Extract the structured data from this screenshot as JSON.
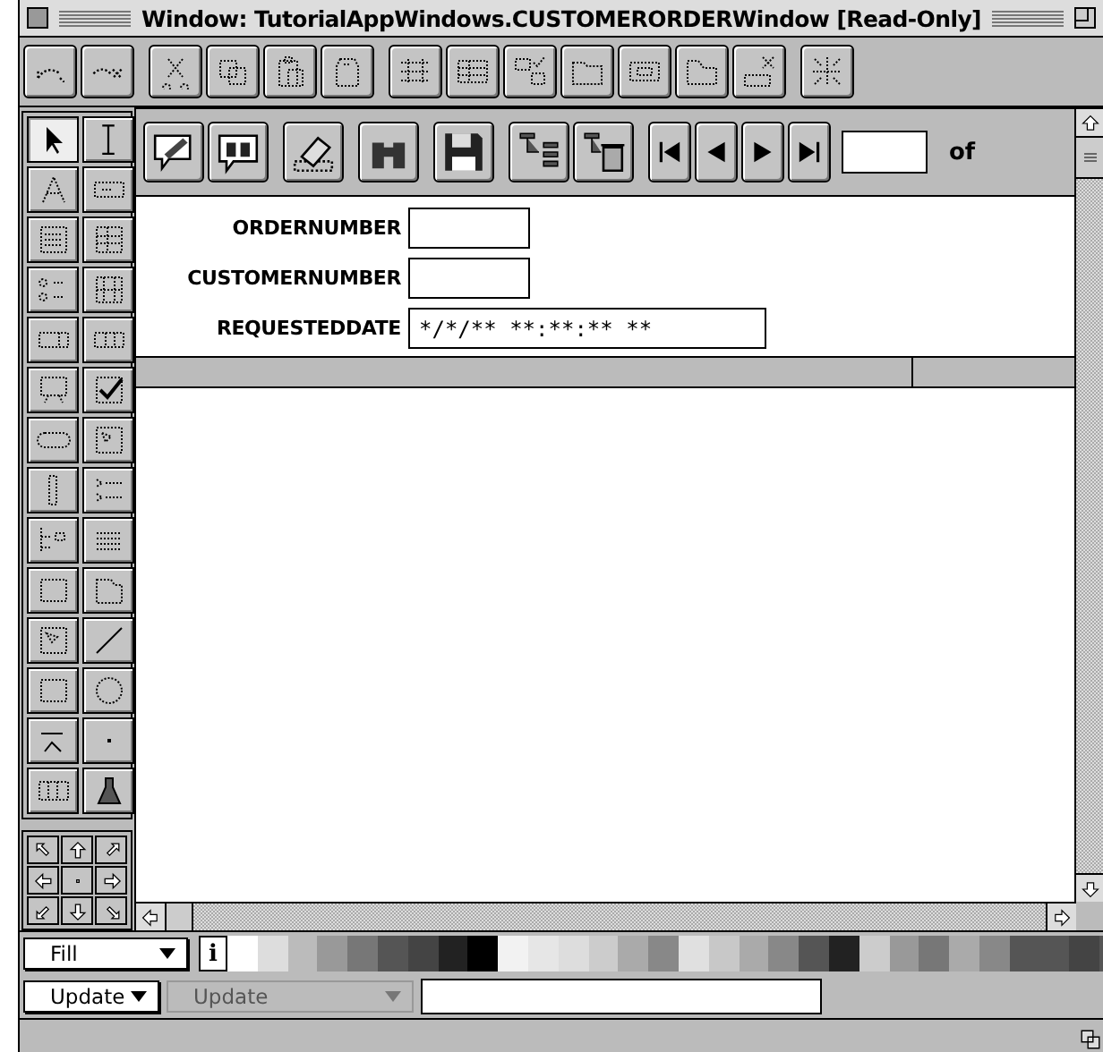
{
  "window": {
    "title": "Window: TutorialAppWindows.CUSTOMERORDERWindow [Read-Only]"
  },
  "tools": [
    {
      "selected": true
    },
    {
      "selected": false
    },
    {
      "selected": false
    },
    {
      "selected": false
    },
    {
      "selected": false
    },
    {
      "selected": false
    },
    {
      "selected": false
    },
    {
      "selected": false
    },
    {
      "selected": false
    },
    {
      "selected": false
    },
    {
      "selected": false
    },
    {
      "selected": false
    },
    {
      "selected": false
    },
    {
      "selected": false
    },
    {
      "selected": false
    },
    {
      "selected": false
    },
    {
      "selected": false
    },
    {
      "selected": false
    },
    {
      "selected": false
    },
    {
      "selected": false
    },
    {
      "selected": false
    },
    {
      "selected": false
    },
    {
      "selected": false
    },
    {
      "selected": false
    },
    {
      "selected": false
    },
    {
      "selected": false
    },
    {
      "selected": false
    },
    {
      "selected": false
    }
  ],
  "record_nav": {
    "of_label": "of"
  },
  "fields": [
    {
      "label": "ORDERNUMBER",
      "wide": false
    },
    {
      "label": "CUSTOMERNUMBER",
      "wide": false
    },
    {
      "label": "REQUESTEDDATE",
      "value": "*/*/** **:**:** **",
      "wide": true
    }
  ],
  "fill": {
    "label": "Fill",
    "info": "i"
  },
  "swatches": [
    {
      "color": "#ffffff"
    },
    {
      "color": "#dddddd"
    },
    {
      "color": "#bbbbbb"
    },
    {
      "color": "#999999"
    },
    {
      "color": "#777777"
    },
    {
      "color": "#555555"
    },
    {
      "color": "#444444"
    },
    {
      "color": "#222222"
    },
    {
      "color": "#000000"
    },
    {
      "color": "#f2f2f2"
    },
    {
      "color": "#e6e6e6"
    },
    {
      "color": "#dddddd"
    },
    {
      "color": "#cccccc"
    },
    {
      "color": "#aaaaaa"
    },
    {
      "color": "#888888"
    },
    {
      "color": "#e0e0e0"
    },
    {
      "color": "#c8c8c8"
    },
    {
      "color": "#aaaaaa"
    },
    {
      "color": "#888888"
    },
    {
      "color": "#555555"
    },
    {
      "color": "#222222"
    },
    {
      "color": "#cccccc"
    },
    {
      "color": "#999999"
    },
    {
      "color": "#777777"
    },
    {
      "color": "#aaaaaa"
    },
    {
      "color": "#888888"
    },
    {
      "color": "#555555"
    },
    {
      "color": "#555555"
    },
    {
      "color": "#444444"
    },
    {
      "color": "#555555"
    }
  ],
  "update_bar": {
    "action": "Update",
    "secondary": "Update",
    "secondary_disabled": true
  }
}
